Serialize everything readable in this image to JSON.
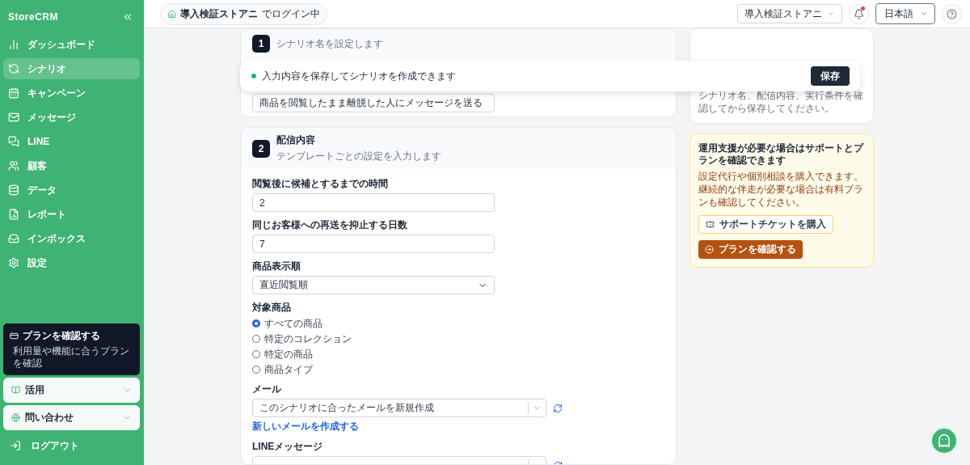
{
  "sidebar": {
    "logo": "StoreCRM",
    "items": [
      {
        "label": "ダッシュボード",
        "selected": false
      },
      {
        "label": "シナリオ",
        "selected": true
      },
      {
        "label": "キャンペーン",
        "selected": false
      },
      {
        "label": "メッセージ",
        "selected": false
      },
      {
        "label": "LINE",
        "selected": false
      },
      {
        "label": "顧客",
        "selected": false
      },
      {
        "label": "データ",
        "selected": false
      },
      {
        "label": "レポート",
        "selected": false
      },
      {
        "label": "インボックス",
        "selected": false
      },
      {
        "label": "設定",
        "selected": false
      }
    ],
    "plan_card": {
      "title": "プランを確認する",
      "subtitle": "利用量や機能に合うプランを確認"
    },
    "accordions": [
      {
        "label": "活用",
        "expanded": false
      },
      {
        "label": "問い合わせ",
        "expanded": false
      }
    ],
    "logout": "ログアウト"
  },
  "header": {
    "store_badge": {
      "name": "導入検証ストアニ",
      "suffix": "でログイン中"
    },
    "store_select": "導入検証ストアニ",
    "notification": {
      "unread": true
    },
    "language": "日本語"
  },
  "toast": {
    "message": "入力内容を保存してシナリオを作成できます",
    "button": "保存"
  },
  "sections": [
    {
      "step": "1",
      "subtitle": "シナリオ名を設定します",
      "fields": [
        {
          "kind": "text",
          "value": "商品を閲覧したまま離脱した人にメッセージを送る"
        }
      ]
    },
    {
      "step": "2",
      "title": "配信内容",
      "subtitle": "テンプレートごとの設定を入力します",
      "fields": [
        {
          "kind": "text",
          "label": "閲覧後に候補とするまでの時間",
          "value": "2"
        },
        {
          "kind": "text",
          "label": "同じお客様への再送を抑止する日数",
          "value": "7"
        },
        {
          "kind": "select",
          "label": "商品表示順",
          "value": "直近閲覧順"
        },
        {
          "kind": "radio",
          "label": "対象商品",
          "options": [
            {
              "label": "すべての商品",
              "selected": true
            },
            {
              "label": "特定のコレクション",
              "selected": false
            },
            {
              "label": "特定の商品",
              "selected": false
            },
            {
              "label": "商品タイプ",
              "selected": false
            }
          ]
        },
        {
          "kind": "combo",
          "label": "メール",
          "value": "このシナリオに合ったメールを新規作成",
          "link": "新しいメールを作成する"
        },
        {
          "kind": "combo",
          "label": "LINEメッセージ"
        }
      ]
    }
  ],
  "side_cards": [
    {
      "kind": "info",
      "text": "シナリオ名、配信内容、実行条件を確認してから保存してください。"
    },
    {
      "kind": "support",
      "title": "運用支援が必要な場合はサポートとプランを確認できます",
      "text": "設定代行や個別相談を購入できます。継続的な伴走が必要な場合は有料プランも確認してください。",
      "buttons": [
        {
          "kind": "outline",
          "label": "サポートチケットを購入"
        },
        {
          "kind": "primary",
          "label": "プランを確認する"
        }
      ]
    }
  ]
}
